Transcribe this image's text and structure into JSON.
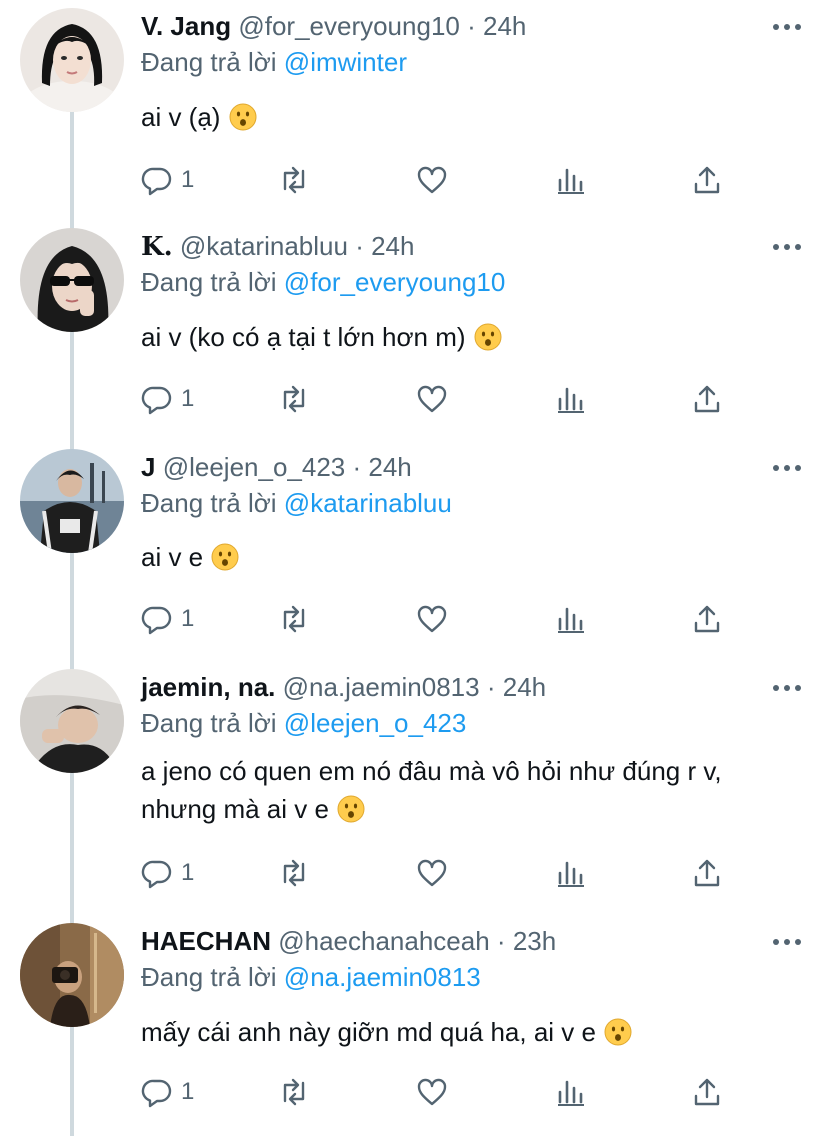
{
  "labels": {
    "replying_prefix": "Đang trả lời",
    "sep": "·"
  },
  "tweets": [
    {
      "name": "V. Jang",
      "handle": "@for_everyoung10",
      "time": "24h",
      "replying_to": "@imwinter",
      "text": "ai v (ạ)",
      "emoji": "hushed-face-emoji",
      "reply_count": "1"
    },
    {
      "name": "𝐊.",
      "handle": "@katarinabluu",
      "time": "24h",
      "replying_to": "@for_everyoung10",
      "text": "ai v (ko có ạ tại t lớn hơn m)",
      "emoji": "hushed-face-emoji",
      "reply_count": "1"
    },
    {
      "name": "J",
      "handle": "@leejen_o_423",
      "time": "24h",
      "replying_to": "@katarinabluu",
      "text": "ai v e",
      "emoji": "hushed-face-emoji",
      "reply_count": "1"
    },
    {
      "name": "jaemin, na.",
      "handle": "@na.jaemin0813",
      "time": "24h",
      "replying_to": "@leejen_o_423",
      "text_line1": "a jeno có quen em nó đâu mà vô hỏi như đúng r v,",
      "text_line2": "nhưng mà ai v e",
      "emoji": "hushed-face-emoji",
      "reply_count": "1"
    },
    {
      "name": "HAECHAN",
      "handle": "@haechanahceah",
      "time": "23h",
      "replying_to": "@na.jaemin0813",
      "text": "mấy cái anh này giỡn md quá ha, ai v e",
      "emoji": "hushed-face-emoji",
      "reply_count": "1"
    }
  ],
  "icons": {
    "reply": "reply-icon",
    "retweet": "retweet-icon",
    "like": "like-icon",
    "views": "views-icon",
    "share": "share-icon",
    "more": "more-icon"
  },
  "colors": {
    "link": "#1d9bf0",
    "secondary_text": "#536471",
    "primary_text": "#0f1419",
    "thread_line": "#cfd9de"
  }
}
